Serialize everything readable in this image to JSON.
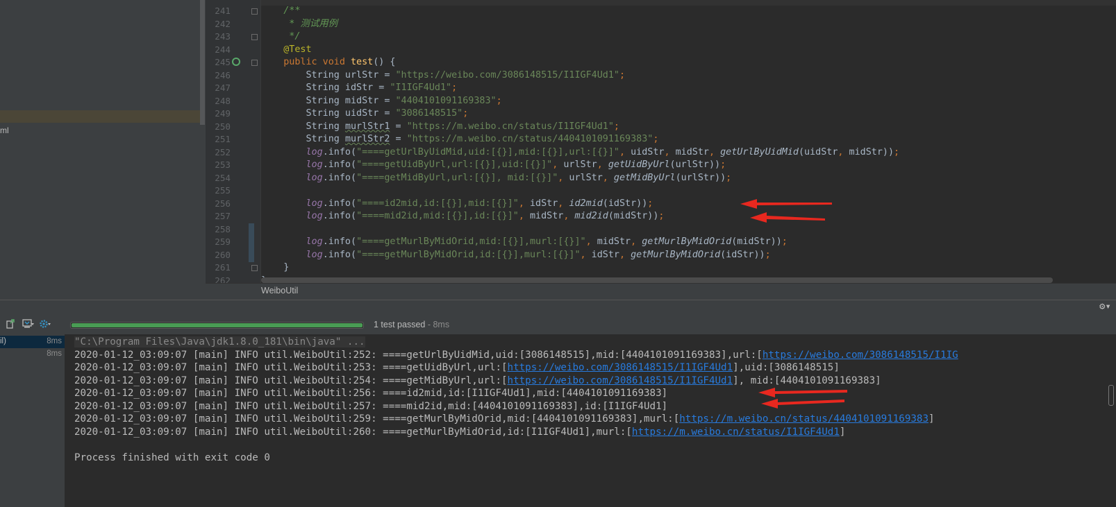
{
  "project_panel": {
    "partial_label": "ml"
  },
  "editor": {
    "lines": [
      {
        "no": "241",
        "segs": [
          {
            "t": "    /**",
            "c": "com"
          }
        ]
      },
      {
        "no": "242",
        "segs": [
          {
            "t": "     * 测试用例",
            "c": "com"
          }
        ]
      },
      {
        "no": "243",
        "segs": [
          {
            "t": "     */",
            "c": "com"
          }
        ]
      },
      {
        "no": "244",
        "segs": [
          {
            "t": "    @Test",
            "c": "ann"
          }
        ]
      },
      {
        "no": "245",
        "segs": [
          {
            "t": "    public void ",
            "c": "kw"
          },
          {
            "t": "test",
            "c": "fn"
          },
          {
            "t": "() {"
          }
        ]
      },
      {
        "no": "246",
        "segs": [
          {
            "t": "        String urlStr = "
          },
          {
            "t": "\"https://weibo.com/3086148515/I1IGF4Ud1\"",
            "c": "str"
          },
          {
            "t": ";",
            "c": "kw"
          }
        ]
      },
      {
        "no": "247",
        "segs": [
          {
            "t": "        String idStr = "
          },
          {
            "t": "\"I1IGF4Ud1\"",
            "c": "str"
          },
          {
            "t": ";",
            "c": "kw"
          }
        ]
      },
      {
        "no": "248",
        "segs": [
          {
            "t": "        String midStr = "
          },
          {
            "t": "\"4404101091169383\"",
            "c": "str"
          },
          {
            "t": ";",
            "c": "kw"
          }
        ]
      },
      {
        "no": "249",
        "segs": [
          {
            "t": "        String uidStr = "
          },
          {
            "t": "\"3086148515\"",
            "c": "str"
          },
          {
            "t": ";",
            "c": "kw"
          }
        ]
      },
      {
        "no": "250",
        "segs": [
          {
            "t": "        String "
          },
          {
            "t": "murlStr1",
            "c": "wavy"
          },
          {
            "t": " = "
          },
          {
            "t": "\"https://m.weibo.cn/status/I1IGF4Ud1\"",
            "c": "str"
          },
          {
            "t": ";",
            "c": "kw"
          }
        ]
      },
      {
        "no": "251",
        "segs": [
          {
            "t": "        String "
          },
          {
            "t": "murlStr2",
            "c": "wavy"
          },
          {
            "t": " = "
          },
          {
            "t": "\"https://m.weibo.cn/status/4404101091169383\"",
            "c": "str"
          },
          {
            "t": ";",
            "c": "kw"
          }
        ]
      },
      {
        "no": "252",
        "segs": [
          {
            "t": "        "
          },
          {
            "t": "log",
            "c": "log"
          },
          {
            "t": ".info("
          },
          {
            "t": "\"====getUrlByUidMid,uid:[{}],mid:[{}],url:[{}]\"",
            "c": "str"
          },
          {
            "t": ", ",
            "c": "kw"
          },
          {
            "t": "uidStr"
          },
          {
            "t": ", ",
            "c": "kw"
          },
          {
            "t": "midStr"
          },
          {
            "t": ", ",
            "c": "kw"
          },
          {
            "t": "getUrlByUidMid",
            "c": "it"
          },
          {
            "t": "(uidStr"
          },
          {
            "t": ", ",
            "c": "kw"
          },
          {
            "t": "midStr))"
          },
          {
            "t": ";",
            "c": "kw"
          }
        ]
      },
      {
        "no": "253",
        "segs": [
          {
            "t": "        "
          },
          {
            "t": "log",
            "c": "log"
          },
          {
            "t": ".info("
          },
          {
            "t": "\"====getUidByUrl,url:[{}],uid:[{}]\"",
            "c": "str"
          },
          {
            "t": ", ",
            "c": "kw"
          },
          {
            "t": "urlStr"
          },
          {
            "t": ", ",
            "c": "kw"
          },
          {
            "t": "getUidByUrl",
            "c": "it"
          },
          {
            "t": "(urlStr))"
          },
          {
            "t": ";",
            "c": "kw"
          }
        ]
      },
      {
        "no": "254",
        "segs": [
          {
            "t": "        "
          },
          {
            "t": "log",
            "c": "log"
          },
          {
            "t": ".info("
          },
          {
            "t": "\"====getMidByUrl,url:[{}], mid:[{}]\"",
            "c": "str"
          },
          {
            "t": ", ",
            "c": "kw"
          },
          {
            "t": "urlStr"
          },
          {
            "t": ", ",
            "c": "kw"
          },
          {
            "t": "getMidByUrl",
            "c": "it"
          },
          {
            "t": "(urlStr))"
          },
          {
            "t": ";",
            "c": "kw"
          }
        ]
      },
      {
        "no": "255",
        "segs": [
          {
            "t": ""
          }
        ]
      },
      {
        "no": "256",
        "segs": [
          {
            "t": "        "
          },
          {
            "t": "log",
            "c": "log"
          },
          {
            "t": ".info("
          },
          {
            "t": "\"====id2mid,id:[{}],mid:[{}]\"",
            "c": "str"
          },
          {
            "t": ", ",
            "c": "kw"
          },
          {
            "t": "idStr"
          },
          {
            "t": ", ",
            "c": "kw"
          },
          {
            "t": "id2mid",
            "c": "it"
          },
          {
            "t": "(idStr))"
          },
          {
            "t": ";",
            "c": "kw"
          }
        ]
      },
      {
        "no": "257",
        "segs": [
          {
            "t": "        "
          },
          {
            "t": "log",
            "c": "log"
          },
          {
            "t": ".info("
          },
          {
            "t": "\"====mid2id,mid:[{}],id:[{}]\"",
            "c": "str"
          },
          {
            "t": ", ",
            "c": "kw"
          },
          {
            "t": "midStr"
          },
          {
            "t": ", ",
            "c": "kw"
          },
          {
            "t": "mid2id",
            "c": "it"
          },
          {
            "t": "(midStr))"
          },
          {
            "t": ";",
            "c": "kw"
          }
        ]
      },
      {
        "no": "258",
        "segs": [
          {
            "t": ""
          }
        ]
      },
      {
        "no": "259",
        "segs": [
          {
            "t": "        "
          },
          {
            "t": "log",
            "c": "log"
          },
          {
            "t": ".info("
          },
          {
            "t": "\"====getMurlByMidOrid,mid:[{}],murl:[{}]\"",
            "c": "str"
          },
          {
            "t": ", ",
            "c": "kw"
          },
          {
            "t": "midStr"
          },
          {
            "t": ", ",
            "c": "kw"
          },
          {
            "t": "getMurlByMidOrid",
            "c": "it"
          },
          {
            "t": "(midStr))"
          },
          {
            "t": ";",
            "c": "kw"
          }
        ]
      },
      {
        "no": "260",
        "segs": [
          {
            "t": "        "
          },
          {
            "t": "log",
            "c": "log"
          },
          {
            "t": ".info("
          },
          {
            "t": "\"====getMurlByMidOrid,id:[{}],murl:[{}]\"",
            "c": "str"
          },
          {
            "t": ", ",
            "c": "kw"
          },
          {
            "t": "idStr"
          },
          {
            "t": ", ",
            "c": "kw"
          },
          {
            "t": "getMurlByMidOrid",
            "c": "it"
          },
          {
            "t": "(idStr))"
          },
          {
            "t": ";",
            "c": "kw"
          }
        ]
      },
      {
        "no": "261",
        "segs": [
          {
            "t": "    }"
          }
        ]
      },
      {
        "no": "262",
        "segs": [
          {
            "t": "}"
          }
        ]
      }
    ]
  },
  "breadcrumb": {
    "class_name": "WeiboUtil"
  },
  "run": {
    "status_text": "1 test passed",
    "status_duration": " - 8ms",
    "progress_fraction": 1.0,
    "tree": [
      {
        "label": "il)",
        "time": "8ms"
      },
      {
        "label": "",
        "time": "8ms"
      }
    ],
    "console": {
      "command": "\"C:\\Program Files\\Java\\jdk1.8.0_181\\bin\\java\" ...",
      "lines": [
        {
          "text": "2020-01-12_03:09:07 [main] INFO util.WeiboUtil:252: ====getUrlByUidMid,uid:[3086148515],mid:[4404101091169383],url:[",
          "link": "https://weibo.com/3086148515/I1IG",
          "after": ""
        },
        {
          "text": "2020-01-12_03:09:07 [main] INFO util.WeiboUtil:253: ====getUidByUrl,url:[",
          "link": "https://weibo.com/3086148515/I1IGF4Ud1",
          "after": "],uid:[3086148515]"
        },
        {
          "text": "2020-01-12_03:09:07 [main] INFO util.WeiboUtil:254: ====getMidByUrl,url:[",
          "link": "https://weibo.com/3086148515/I1IGF4Ud1",
          "after": "], mid:[4404101091169383]"
        },
        {
          "text": "2020-01-12_03:09:07 [main] INFO util.WeiboUtil:256: ====id2mid,id:[I1IGF4Ud1],mid:[4404101091169383]",
          "link": "",
          "after": ""
        },
        {
          "text": "2020-01-12_03:09:07 [main] INFO util.WeiboUtil:257: ====mid2id,mid:[4404101091169383],id:[I1IGF4Ud1]",
          "link": "",
          "after": ""
        },
        {
          "text": "2020-01-12_03:09:07 [main] INFO util.WeiboUtil:259: ====getMurlByMidOrid,mid:[4404101091169383],murl:[",
          "link": "https://m.weibo.cn/status/4404101091169383",
          "after": "]"
        },
        {
          "text": "2020-01-12_03:09:07 [main] INFO util.WeiboUtil:260: ====getMurlByMidOrid,id:[I1IGF4Ud1],murl:[",
          "link": "https://m.weibo.cn/status/I1IGF4Ud1",
          "after": "]"
        }
      ],
      "exit_message": "Process finished with exit code 0"
    }
  },
  "icons": {
    "run_gutter": "run-test-icon",
    "toolbar": [
      "export-test-results-icon",
      "import-tests-icon",
      "settings-icon"
    ],
    "header": "gear-icon",
    "annotations": "red-arrow-icon"
  },
  "colors": {
    "arrow": "#e8281f",
    "progress": "#499c54",
    "link": "#287bde"
  }
}
